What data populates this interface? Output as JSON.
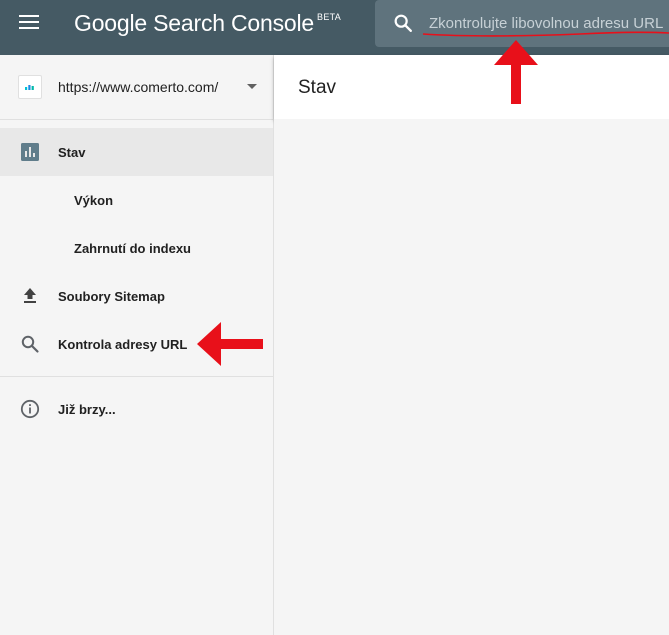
{
  "app": {
    "title": "Google Search Console",
    "badge": "BETA"
  },
  "search": {
    "placeholder": "Zkontrolujte libovolnou adresu URL",
    "icon": "search-icon"
  },
  "property": {
    "url": "https://www.comerto.com/"
  },
  "sidebar": {
    "items": [
      {
        "label": "Stav",
        "icon": "bar-chart-icon",
        "active": true
      },
      {
        "label": "Výkon"
      },
      {
        "label": "Zahrnutí do indexu"
      },
      {
        "label": "Soubory Sitemap",
        "icon": "upload-icon"
      },
      {
        "label": "Kontrola adresy URL",
        "icon": "search-icon"
      },
      {
        "label": "Již brzy...",
        "icon": "info-icon"
      }
    ]
  },
  "main": {
    "title": "Stav"
  },
  "colors": {
    "topbar": "#455a64",
    "annotation": "#e8101a"
  }
}
